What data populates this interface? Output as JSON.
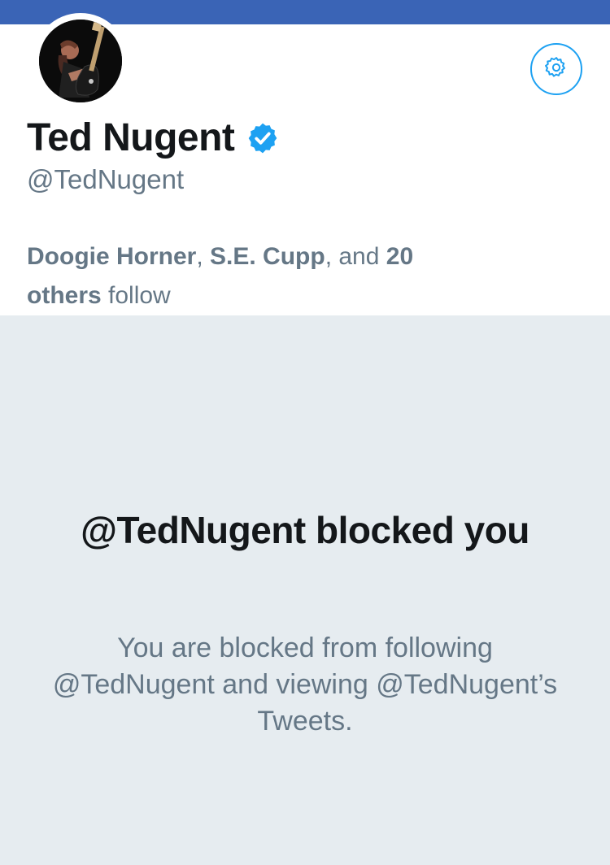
{
  "profile": {
    "name": "Ted Nugent",
    "handle": "@TedNugent",
    "verified": true,
    "avatar_icon": "profile-photo-guitarist",
    "settings_icon": "gear-icon",
    "followers_known": {
      "user1": "Doogie Horner",
      "separator1": ", ",
      "user2": "S.E. Cupp",
      "separator2": ", and ",
      "count": "20",
      "count_label": "others",
      "suffix": " follow"
    }
  },
  "blocked": {
    "title": "@TedNugent blocked you",
    "description": "You are blocked from following @TedNugent and viewing @TedNugent’s Tweets."
  },
  "colors": {
    "banner": "#3a64b6",
    "accent": "#1da1f2",
    "background": "#e6ecf0",
    "primary_text": "#14171a",
    "secondary_text": "#657786"
  }
}
